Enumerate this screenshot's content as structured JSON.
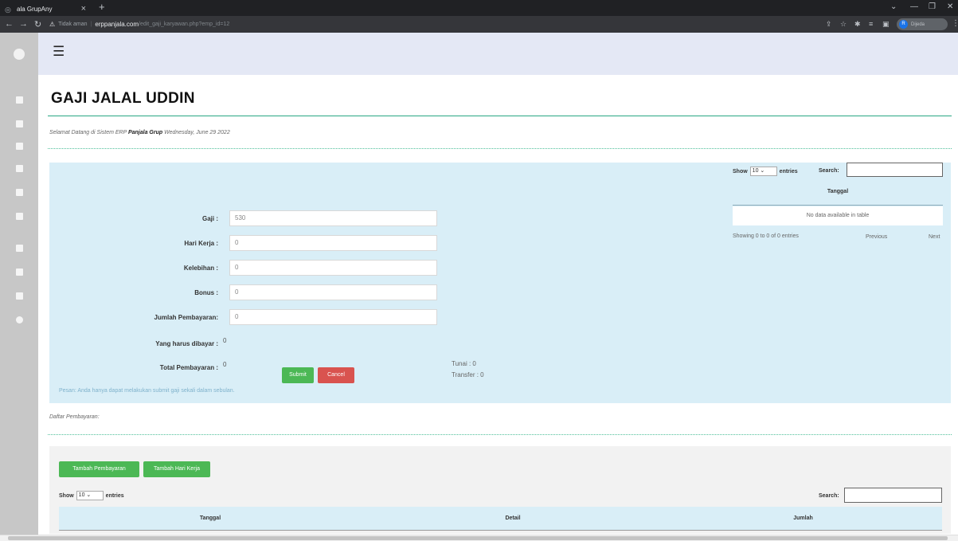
{
  "browser": {
    "tab_title": "ala GrupAny",
    "tab_close": "×",
    "new_tab": "+",
    "security_label": "Tidak aman",
    "url_host": "erppanjala.com",
    "url_path": "/edit_gaji_karyawan.php?emp_id=12",
    "profile_label": "Dijeda",
    "profile_initial": "R"
  },
  "app": {
    "page_title": "GAJI JALAL UDDIN",
    "welcome_prefix": "Selamat Datang di Sistem ERP ",
    "welcome_brand": "Panjala Grup",
    "welcome_date": " Wednesday, June 29 2022"
  },
  "form": {
    "gaji_label": "Gaji :",
    "gaji_value": "530",
    "hari_kerja_label": "Hari Kerja :",
    "hari_kerja_value": "0",
    "kelebihan_label": "Kelebihan :",
    "kelebihan_value": "0",
    "bonus_label": "Bonus :",
    "bonus_value": "0",
    "jumlah_label": "Jumlah Pembayaran:",
    "jumlah_value": "0",
    "harus_label": "Yang harus dibayar :",
    "harus_value": "0",
    "total_label": "Total Pembayaran :",
    "total_value": "0",
    "tunai_text": "Tunai : 0",
    "transfer_text": "Transfer : 0",
    "submit_label": "Submit",
    "cancel_label": "Cancel",
    "notice": "Pesan: Anda hanya dapat melakukan submit gaji sekali dalam sebulan."
  },
  "mini_table": {
    "show_label": "Show",
    "entries_value": "10",
    "entries_label": "entries",
    "search_label": "Search:",
    "column": "Tanggal",
    "empty_text": "No data available in table",
    "info_text": "Showing 0 to 0 of 0 entries",
    "prev_label": "Previous",
    "next_label": "Next"
  },
  "payments": {
    "daftar_label": "Daftar Pembayaran:",
    "tambah_pembayaran_label": "Tambah Pembayaran",
    "tambah_hari_label": "Tambah Hari Kerja",
    "show_label": "Show",
    "entries_value": "10",
    "entries_label": "entries",
    "search_label": "Search:",
    "columns": [
      "Tanggal",
      "Detail",
      "Jumlah"
    ]
  },
  "colors": {
    "accent_green": "#4cb855",
    "danger_red": "#d9534f",
    "panel_blue": "#d9eef7",
    "title_line": "#2aa783"
  }
}
